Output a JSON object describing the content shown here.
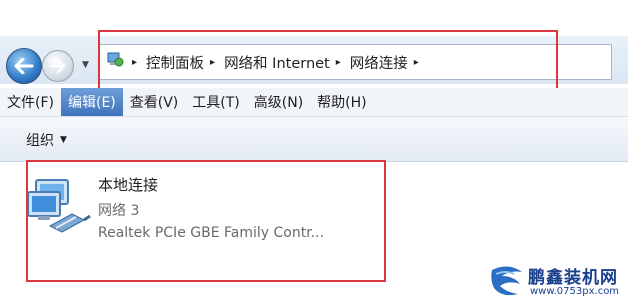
{
  "address_bar": {
    "breadcrumbs": [
      "控制面板",
      "网络和 Internet",
      "网络连接"
    ],
    "separator": "▸"
  },
  "menu": [
    {
      "label": "文件(F)",
      "active": false
    },
    {
      "label": "编辑(E)",
      "active": true
    },
    {
      "label": "查看(V)",
      "active": false
    },
    {
      "label": "工具(T)",
      "active": false
    },
    {
      "label": "高级(N)",
      "active": false
    },
    {
      "label": "帮助(H)",
      "active": false
    }
  ],
  "toolbar": {
    "organize_label": "组织",
    "caret": "▼"
  },
  "connection": {
    "name": "本地连接",
    "network": "网络  3",
    "adapter": "Realtek PCIe GBE Family Contr..."
  },
  "watermark": {
    "title": "鹏鑫装机网",
    "url": "www.0753px.com"
  },
  "colors": {
    "highlight_box": "#d9363e",
    "menu_active": "#3e74bd",
    "watermark": "#1a3f8f"
  }
}
